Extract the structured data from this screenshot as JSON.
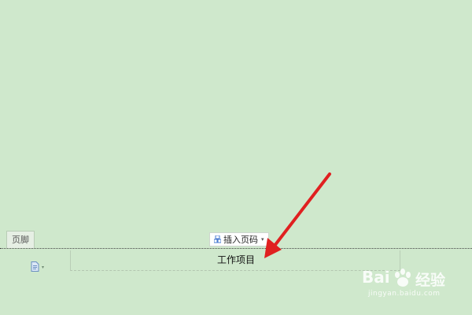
{
  "footer": {
    "tab_label": "页脚",
    "insert_page_number_label": "插入页码",
    "insert_page_number_arrow": "▾",
    "text": "工作项目",
    "options_arrow": "▾"
  },
  "annotation": {
    "arrow_color": "#e02020"
  },
  "watermark": {
    "logo_left": "Bai",
    "logo_right": "经验",
    "url": "jingyan.baidu.com"
  },
  "colors": {
    "background": "#cfe8cc",
    "accent_blue": "#4a7bd0"
  }
}
